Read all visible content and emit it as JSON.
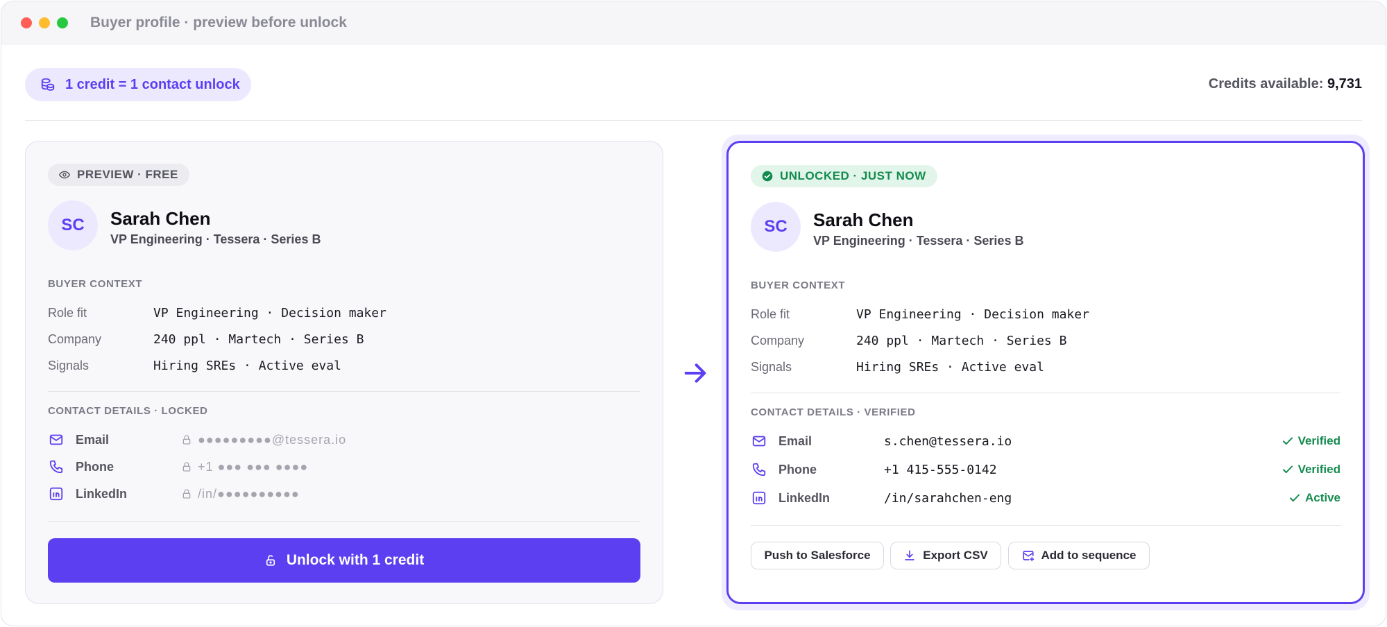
{
  "window": {
    "title": "Buyer profile · preview before unlock"
  },
  "header": {
    "credit_pill": "1 credit = 1 contact unlock",
    "credits_label": "Credits available:",
    "credits_value": "9,731"
  },
  "preview_card": {
    "badge": "PREVIEW · FREE",
    "avatar_initials": "SC",
    "name": "Sarah Chen",
    "role": "VP Engineering · Tessera · Series B",
    "context_label": "BUYER CONTEXT",
    "context": [
      {
        "key": "Role fit",
        "value": "VP Engineering · Decision maker"
      },
      {
        "key": "Company",
        "value": "240 ppl · Martech · Series B"
      },
      {
        "key": "Signals",
        "value": "Hiring SREs · Active eval"
      }
    ],
    "contacts_label": "CONTACT DETAILS · LOCKED",
    "contacts": [
      {
        "key": "Email",
        "value": "●●●●●●●●●@tessera.io",
        "icon": "mail-icon"
      },
      {
        "key": "Phone",
        "value": "+1 ●●● ●●● ●●●●",
        "icon": "phone-icon"
      },
      {
        "key": "LinkedIn",
        "value": "/in/●●●●●●●●●●",
        "icon": "linkedin-icon"
      }
    ],
    "unlock_button": "Unlock with 1 credit"
  },
  "unlocked_card": {
    "badge": "UNLOCKED · JUST NOW",
    "avatar_initials": "SC",
    "name": "Sarah Chen",
    "role": "VP Engineering · Tessera · Series B",
    "context_label": "BUYER CONTEXT",
    "context": [
      {
        "key": "Role fit",
        "value": "VP Engineering · Decision maker"
      },
      {
        "key": "Company",
        "value": "240 ppl · Martech · Series B"
      },
      {
        "key": "Signals",
        "value": "Hiring SREs · Active eval"
      }
    ],
    "contacts_label": "CONTACT DETAILS · VERIFIED",
    "contacts": [
      {
        "key": "Email",
        "value": "s.chen@tessera.io",
        "status": "Verified",
        "icon": "mail-icon"
      },
      {
        "key": "Phone",
        "value": "+1 415-555-0142",
        "status": "Verified",
        "icon": "phone-icon"
      },
      {
        "key": "LinkedIn",
        "value": "/in/sarahchen-eng",
        "status": "Active",
        "icon": "linkedin-icon"
      }
    ],
    "actions": {
      "salesforce": "Push to Salesforce",
      "csv": "Export CSV",
      "sequence": "Add to sequence"
    }
  },
  "colors": {
    "accent": "#5b3ff0",
    "accent_soft": "#ece9ff",
    "success": "#138a4d",
    "success_soft": "#e1f5ea"
  }
}
